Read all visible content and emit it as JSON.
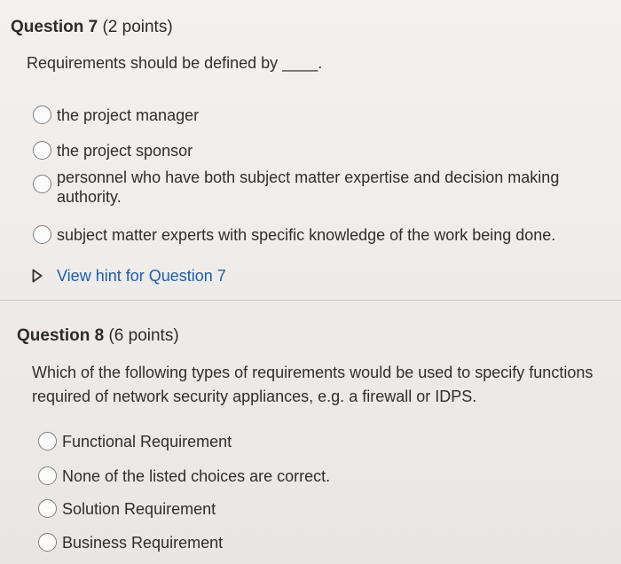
{
  "q7": {
    "number": "Question 7",
    "points": " (2 points)",
    "prompt": "Requirements should be defined by ____.",
    "options": [
      {
        "label": "the project manager"
      },
      {
        "label": "the project sponsor"
      },
      {
        "label": "personnel who have both subject matter expertise and decision making authority."
      },
      {
        "label": "subject matter experts with specific knowledge of the work being done."
      }
    ],
    "hint": "View hint for Question 7"
  },
  "q8": {
    "number": "Question 8",
    "points": " (6 points)",
    "prompt": "Which of the following types of requirements would be used to specify functions required of network security appliances, e.g. a firewall or IDPS.",
    "options": [
      {
        "label": "Functional Requirement"
      },
      {
        "label": "None of the listed choices are correct."
      },
      {
        "label": "Solution Requirement"
      },
      {
        "label": "Business Requirement"
      }
    ]
  },
  "icons": {
    "hint_toggle": "play-triangle-outline-icon",
    "option_marker": "radio-circle-icon"
  }
}
